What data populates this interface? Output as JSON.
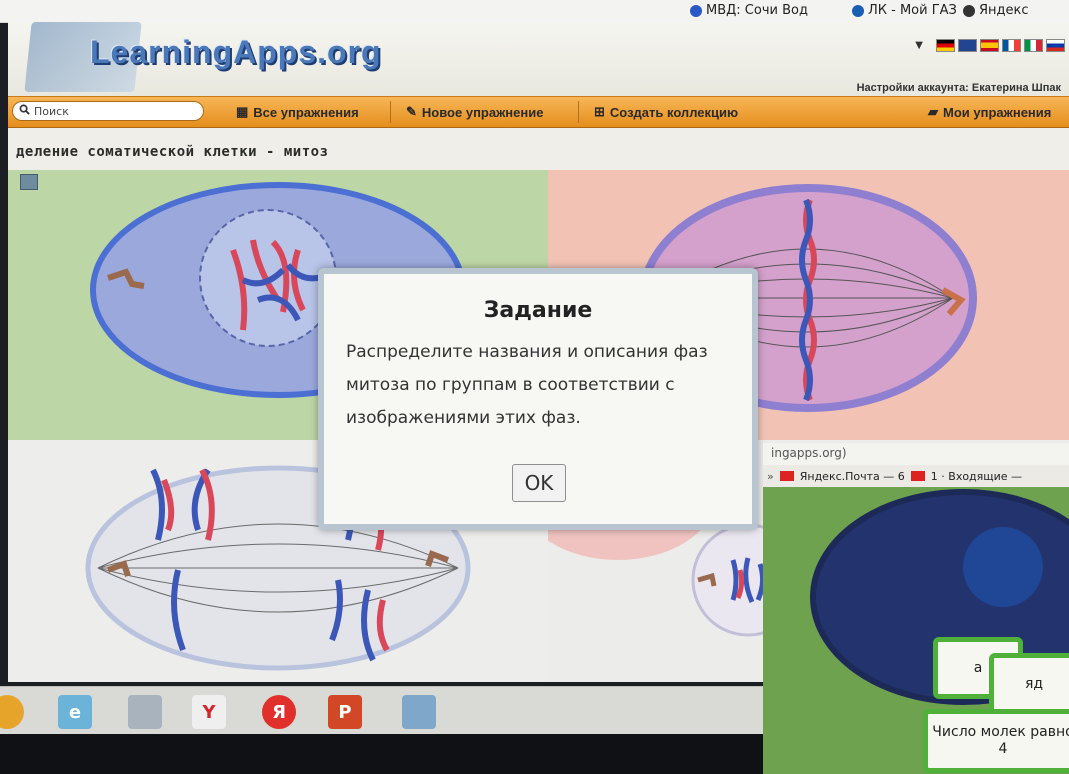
{
  "browser": {
    "bookmarks": [
      {
        "label": "МВД: Сочи  Вод",
        "color": "#2b57c7"
      },
      {
        "label": "ЛК - Мой ГАЗ",
        "color": "#1a5db4"
      },
      {
        "label": "Яндекс",
        "color": "#333333"
      }
    ]
  },
  "header": {
    "logo": "LearningApps.org",
    "account": "Настройки аккаунта: Екатерина Шпак"
  },
  "toolbar": {
    "search_placeholder": "Поиск",
    "all_exercises": "Все упражнения",
    "new_exercise": "Новое упражнение",
    "create_collection": "Создать коллекцию",
    "my_exercises": "Мои упражнения"
  },
  "exercise": {
    "title": "деление соматической клетки - митоз"
  },
  "dialog": {
    "title": "Задание",
    "body": "Распределите названия и описания фаз митоза по группам в соответствии с изображениями этих фаз.",
    "ok": "OK"
  },
  "photo2": {
    "url": "ingapps.org)",
    "bookmarks": [
      "Яндекс.Почта — 6",
      "1 · Входящие —"
    ],
    "cards": [
      "а",
      "яд",
      "Число молек равно 4"
    ]
  },
  "taskbar": {
    "apps": [
      "chrome",
      "edge",
      "printer",
      "yandex-browser",
      "yandex",
      "powerpoint",
      "screenshot"
    ]
  },
  "colors": {
    "toolbar": "#e58e1d",
    "accent_blue": "#4a78b8",
    "green": "#4fb13a"
  }
}
